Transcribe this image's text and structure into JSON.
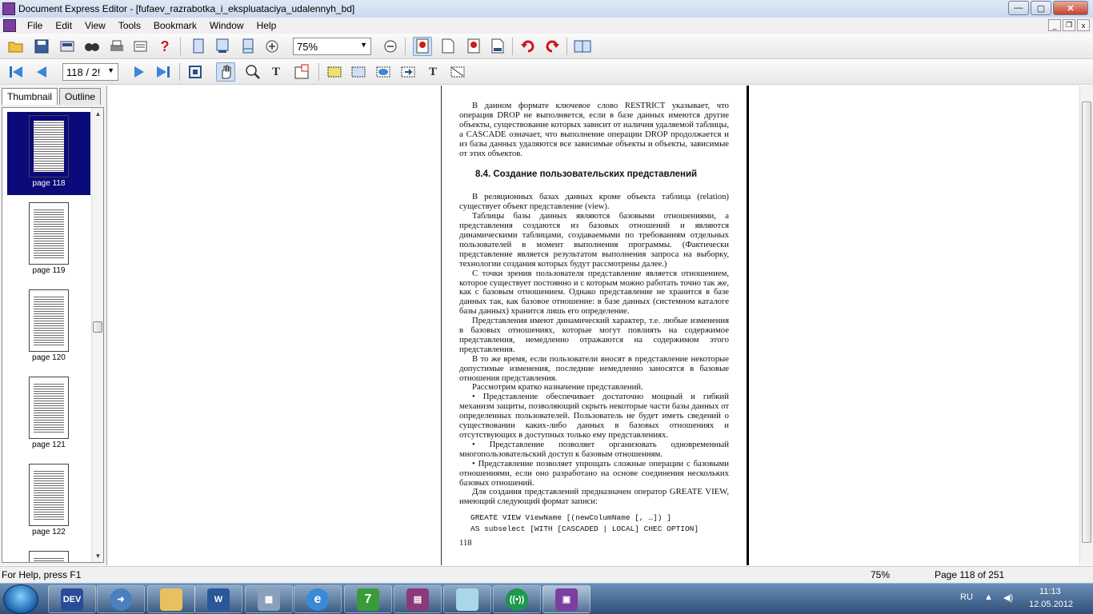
{
  "window": {
    "title": "Document Express Editor - [fufaev_razrabotka_i_ekspluataciya_udalennyh_bd]",
    "controls": {
      "minimize": "—",
      "maximize": "▢",
      "close": "✕"
    }
  },
  "menu": {
    "items": [
      "File",
      "Edit",
      "View",
      "Tools",
      "Bookmark",
      "Window",
      "Help"
    ],
    "mdi": {
      "minimize": "_",
      "restore": "❐",
      "close": "x"
    }
  },
  "toolbar1": {
    "zoom_value": "75%",
    "icons": [
      "open-folder-icon",
      "save-icon",
      "scan-icon",
      "find-icon",
      "print-icon",
      "properties-icon",
      "help-icon",
      "single-page-icon",
      "two-page-icon",
      "continuous-icon",
      "zoom-in-icon",
      "zoom-out-icon",
      "annotate-icon",
      "page-icon",
      "rotate-left-icon",
      "rotate-right-icon",
      "undo-icon",
      "redo-icon",
      "fit-width-icon"
    ]
  },
  "toolbar2": {
    "page_value": "118 / 2!",
    "icons": [
      "first-page-icon",
      "prev-page-icon",
      "next-page-icon",
      "last-page-icon",
      "select-icon",
      "hand-icon",
      "zoom-tool-icon",
      "text-tool-icon",
      "snapshot-icon",
      "select-area-icon"
    ]
  },
  "sidebar": {
    "tabs": [
      "Thumbnail",
      "Outline"
    ],
    "thumbnails": [
      {
        "label": "page 118",
        "selected": true
      },
      {
        "label": "page 119",
        "selected": false
      },
      {
        "label": "page 120",
        "selected": false
      },
      {
        "label": "page 121",
        "selected": false
      },
      {
        "label": "page 122",
        "selected": false
      }
    ]
  },
  "document": {
    "paragraphs_top": [
      "В данном формате ключевое слово RESTRICT указывает, что операция DROP не выполняется, если в базе данных имеются другие объекты, существование которых зависит от наличия удаляемой таблицы, а CASCADE означает, что выполнение операции DROP продолжается и из базы данных удаляются все зависимые объекты и объекты, зависимые от этих объектов."
    ],
    "heading": "8.4. Создание пользовательских представлений",
    "paragraphs": [
      "В реляционных базах данных кроме объекта таблица (relation) существует объект представление (view).",
      "Таблицы базы данных являются базовыми отношениями, а представления создаются из базовых отношений и являются динамическими таблицами, создаваемыми по требованиям отдельных пользователей в момент выполнения программы. (Фактически представление является результатом выполнения запроса на выборку, технологии создания которых будут рассмотрены далее.)",
      "С точки зрения пользователя представление является отношением, которое существует постоянно и с которым можно работать точно так же, как с базовым отношением. Однако представление не хранится в базе данных так, как базовое отношение: в базе данных (системном каталоге базы данных) хранится лишь его определение.",
      "Представления имеют динамический характер, т.е. любые изменения в базовых отношениях, которые могут повлиять на содержимое представления, немедленно отражаются на содержимом этого представления.",
      "В то же время, если пользователи вносят в представление некоторые допустимые изменения, последние немедленно заносятся в базовые отношения представления.",
      "Рассмотрим кратко назначение представлений.",
      "• Представление обеспечивает достаточно мощный и гибкий механизм защиты, позволяющий скрыть некоторые части базы данных от определенных пользователей. Пользователь не будет иметь сведений о существовании каких-либо данных в базовых отношениях и отсутствующих в доступных только ему представлениях.",
      "• Представление позволяет организовать одновременный многопользовательский доступ к базовым отношениям.",
      "• Представление позволяет упрощать сложные операции с базовыми отношениями, если оно разработано на основе соединения нескольких базовых отношений.",
      "Для создания представлений предназначен оператор GREATE VIEW, имеющий следующий формат записи:"
    ],
    "code_line1": "GREATE VIEW ViewName [(newColumName [, …]) ]",
    "code_line2": "AS subselect [WITH [CASCADED | LOCAL] CHEC OPTION]",
    "page_number": "118"
  },
  "statusbar": {
    "help": "For Help, press F1",
    "zoom": "75%",
    "page": "Page 118 of 251"
  },
  "taskbar": {
    "apps": [
      {
        "name": "dev-cpp",
        "label": "DEV"
      },
      {
        "name": "browser-arrow",
        "label": ""
      },
      {
        "name": "explorer",
        "label": ""
      },
      {
        "name": "word",
        "label": "W"
      },
      {
        "name": "calculator",
        "label": ""
      },
      {
        "name": "internet-explorer",
        "label": "e"
      },
      {
        "name": "seven-tool",
        "label": "7"
      },
      {
        "name": "winrar",
        "label": ""
      },
      {
        "name": "notepad",
        "label": ""
      },
      {
        "name": "network-app",
        "label": ""
      },
      {
        "name": "document-express",
        "label": ""
      }
    ],
    "language": "RU",
    "time": "11:13",
    "date": "12.05.2012"
  }
}
